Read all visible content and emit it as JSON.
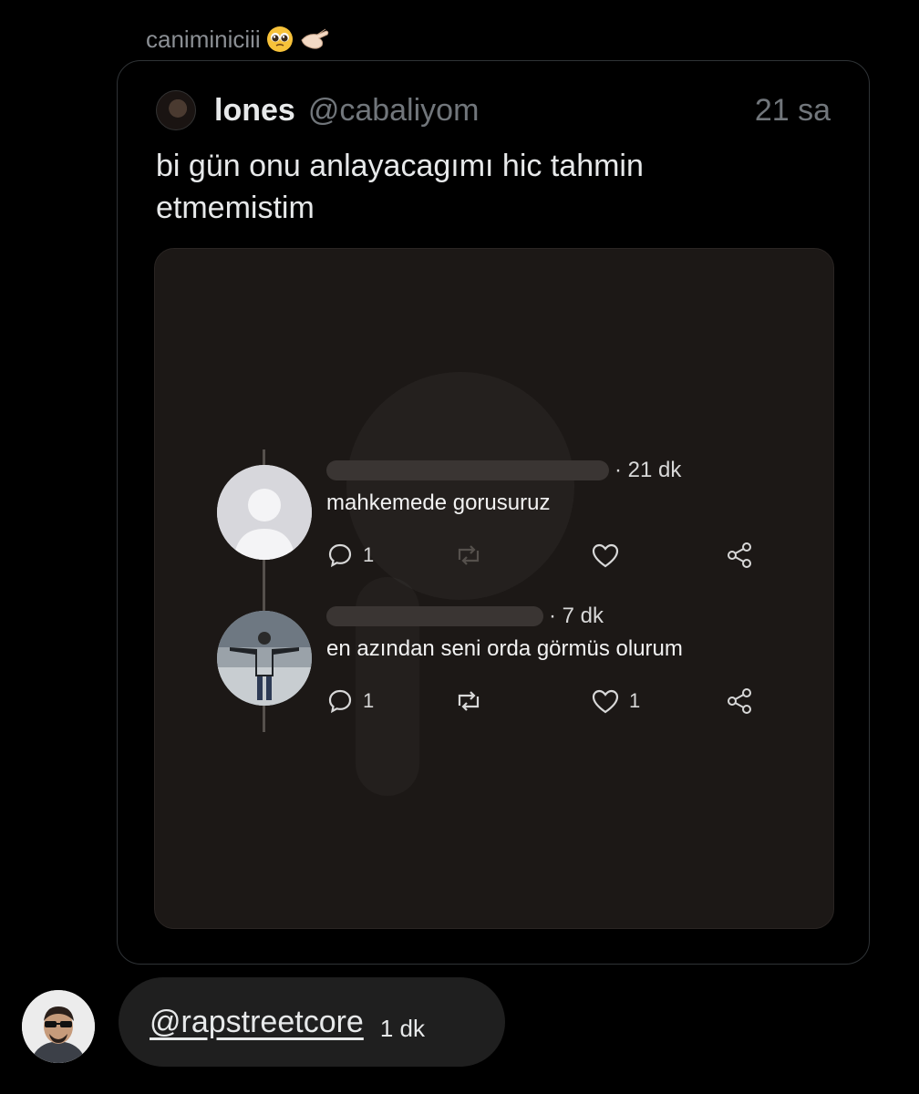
{
  "sender": {
    "name": "caniminiciii",
    "emojis": [
      "pleading-face-icon",
      "pinching-hand-icon"
    ]
  },
  "quote": {
    "display_name": "lones",
    "handle": "@cabaliyom",
    "time": "21 sa",
    "text": "bi gün onu anlayacagımı hic tahmin etmemistim"
  },
  "media": {
    "comments": [
      {
        "time": "· 21 dk",
        "text": "mahkemede gorusuruz",
        "reply_count": "1",
        "like_count": ""
      },
      {
        "time": "· 7 dk",
        "text": "en azından seni orda görmüs olurum",
        "reply_count": "1",
        "like_count": "1"
      }
    ]
  },
  "reply": {
    "mention": "@rapstreetcore",
    "time": "1 dk"
  },
  "colors": {
    "background": "#000000",
    "card_border": "#2f3336",
    "muted_text": "#71767b",
    "bubble": "#1f1f1f"
  }
}
